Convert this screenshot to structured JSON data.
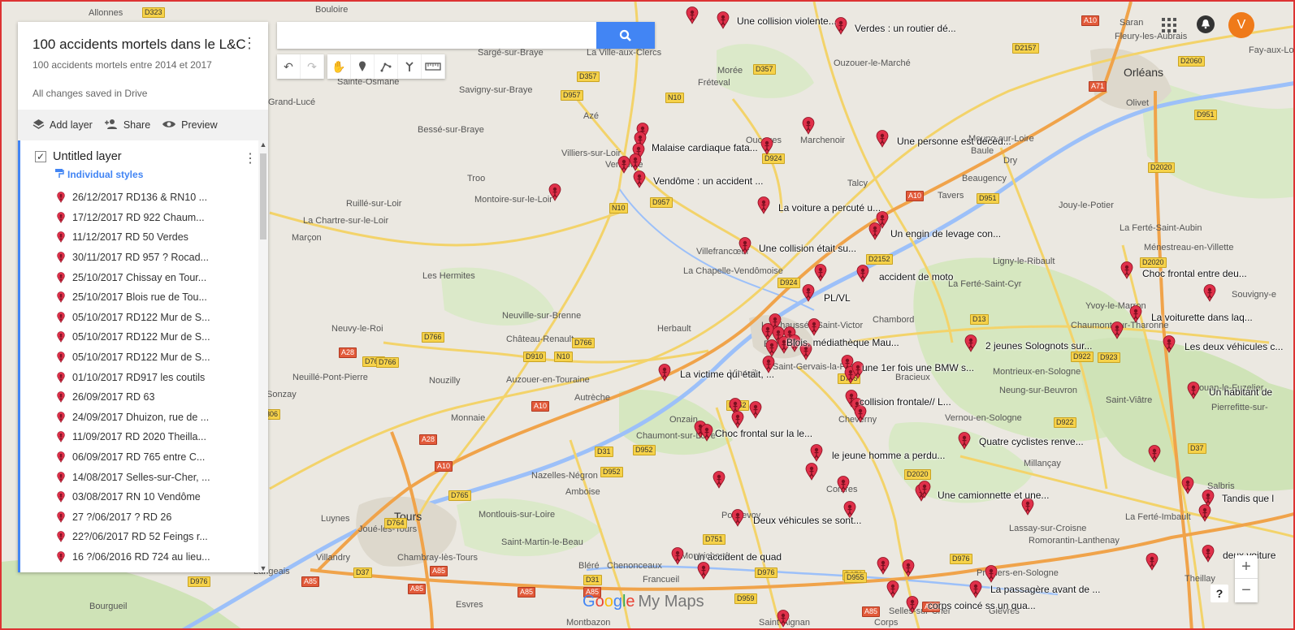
{
  "map_panel": {
    "title": "100 accidents mortels dans le L&C",
    "subtitle": "100 accidents mortels entre 2014 et 2017",
    "saved_status": "All changes saved in Drive",
    "actions": {
      "add_layer": "Add layer",
      "share": "Share",
      "preview": "Preview"
    },
    "layer": {
      "name": "Untitled layer",
      "styles_link": "Individual styles",
      "items": [
        "26/12/2017 RD136 & RN10 ...",
        "17/12/2017  RD 922 Chaum...",
        "11/12/2017 RD 50 Verdes",
        "30/11/2017 RD 957 ?  Rocad...",
        "25/10/2017 Chissay en Tour...",
        "25/10/2017 Blois rue de Tou...",
        "05/10/2017 RD122 Mur de S...",
        "05/10/2017 RD122 Mur de S...",
        "05/10/2017 RD122 Mur de S...",
        "01/10/2017  RD917 les coutils",
        "26/09/2017 RD 63",
        "24/09/2017  Dhuizon, rue de ...",
        "11/09/2017 RD 2020 Theilla...",
        "06/09/2017  RD 765 entre C...",
        "14/08/2017  Selles-sur-Cher, ...",
        "03/08/2017 RN 10 Vendôme",
        "27 ?/06/2017 ? RD 26",
        "22?/06/2017 RD 52 Feings r...",
        "16 ?/06/2016 RD 724 au lieu..."
      ]
    }
  },
  "search": {
    "placeholder": ""
  },
  "toolbar": [
    "undo-icon",
    "redo-icon",
    "hand-icon",
    "marker-icon",
    "draw-line-icon",
    "directions-icon",
    "ruler-icon"
  ],
  "top_right": {
    "avatar_letter": "V"
  },
  "branding": {
    "google": [
      "G",
      "o",
      "o",
      "g",
      "l",
      "e"
    ],
    "product": "My Maps"
  },
  "zoom": {
    "in": "+",
    "out": "−"
  },
  "help": "?",
  "colors": {
    "marker": "#e0304a",
    "accent": "#4285f4",
    "avatar": "#ef7a1a",
    "road_yellow": "#f6d24a",
    "road_red": "#e25a3a"
  },
  "map": {
    "places": [
      {
        "t": "Allonnes"
      },
      {
        "t": "Bouloire"
      },
      {
        "t": "Sargé-sur-Braye"
      },
      {
        "t": "La Ville-aux-Clercs"
      },
      {
        "t": "Morée"
      },
      {
        "t": "Fréteval"
      },
      {
        "t": "Ouzouer-le-Marché"
      },
      {
        "t": "Saran"
      },
      {
        "t": "Fleury-les-Aubrais"
      },
      {
        "t": "Orléans",
        "big": true
      },
      {
        "t": "Olivet"
      },
      {
        "t": "Fay-aux-Log"
      },
      {
        "t": "Sainte-Osmane"
      },
      {
        "t": "Savigny-sur-Braye"
      },
      {
        "t": "Grand-Lucé"
      },
      {
        "t": "Azé"
      },
      {
        "t": "Bessé-sur-Braye"
      },
      {
        "t": "Villiers-sur-Loir"
      },
      {
        "t": "Vendôme"
      },
      {
        "t": "Troo"
      },
      {
        "t": "Montoire-sur-le-Loir"
      },
      {
        "t": "Ruillé-sur-Loir"
      },
      {
        "t": "La Chartre-sur-le-Loir"
      },
      {
        "t": "Marçon"
      },
      {
        "t": "Oucques"
      },
      {
        "t": "Marchenoir"
      },
      {
        "t": "Meung-sur-Loire"
      },
      {
        "t": "Baule"
      },
      {
        "t": "Beaugency"
      },
      {
        "t": "Talcy"
      },
      {
        "t": "Tavers"
      },
      {
        "t": "Jouy-le-Potier"
      },
      {
        "t": "Dry"
      },
      {
        "t": "La Ferté-Saint-Aubin"
      },
      {
        "t": "Ménestreau-en-Villette"
      },
      {
        "t": "Villefrancœur"
      },
      {
        "t": "La Chapelle-Vendômoise"
      },
      {
        "t": "Les Hermites"
      },
      {
        "t": "Ligny-le-Ribault"
      },
      {
        "t": "La Ferté-Saint-Cyr"
      },
      {
        "t": "Yvoy-le-Marron"
      },
      {
        "t": "Souvigny-e"
      },
      {
        "t": "Neuville-sur-Brenne"
      },
      {
        "t": "Château-Renault"
      },
      {
        "t": "Herbault"
      },
      {
        "t": "Chambord"
      },
      {
        "t": "Chaumont-sur-Tharonne"
      },
      {
        "t": "Neuvy-le-Roi"
      },
      {
        "t": "Neuillé-Pont-Pierre"
      },
      {
        "t": "Nouzilly"
      },
      {
        "t": "Auzouer-en-Touraine"
      },
      {
        "t": "Autrèche"
      },
      {
        "t": "Bracieux"
      },
      {
        "t": "Montrieux-en-Sologne"
      },
      {
        "t": "Neung-sur-Beuvron"
      },
      {
        "t": "Sonzay"
      },
      {
        "t": "Monnaie"
      },
      {
        "t": "Onzain"
      },
      {
        "t": "Chaumont-sur-Loire"
      },
      {
        "t": "Cheverny"
      },
      {
        "t": "Vernou-en-Sologne"
      },
      {
        "t": "Saint-Viâtre"
      },
      {
        "t": "Nouan-le-Fuzelier"
      },
      {
        "t": "Pierrefitte-sur-"
      },
      {
        "t": "Nazelles-Négron"
      },
      {
        "t": "Amboise"
      },
      {
        "t": "Millançay"
      },
      {
        "t": "Salbris"
      },
      {
        "t": "Tours",
        "big": true
      },
      {
        "t": "Montlouis-sur-Loire"
      },
      {
        "t": "Pontlevoy"
      },
      {
        "t": "Contres"
      },
      {
        "t": "Luynes"
      },
      {
        "t": "Joué-lès-Tours"
      },
      {
        "t": "Saint-Martin-le-Beau"
      },
      {
        "t": "Lassay-sur-Croisne"
      },
      {
        "t": "La Ferté-Imbault"
      },
      {
        "t": "Chambray-lès-Tours"
      },
      {
        "t": "Romorantin-Lanthenay"
      },
      {
        "t": "Villandry"
      },
      {
        "t": "Chenonceaux"
      },
      {
        "t": "Montrichard"
      },
      {
        "t": "Pruniers-en-Sologne"
      },
      {
        "t": "Langeais"
      },
      {
        "t": "Bléré"
      },
      {
        "t": "Francueil"
      },
      {
        "t": "Theillay"
      },
      {
        "t": "Bourgueil"
      },
      {
        "t": "Esvres"
      },
      {
        "t": "Selles-sur-Cher"
      },
      {
        "t": "Gièvres"
      },
      {
        "t": "Montbazon"
      },
      {
        "t": "Corps"
      },
      {
        "t": "Saint-Aignan"
      },
      {
        "t": "Blois"
      },
      {
        "t": "Vineuil"
      },
      {
        "t": "Saint-Gervais-la-Forêt"
      },
      {
        "t": "La Chaussée-Saint-Victor"
      }
    ],
    "roads": [
      {
        "t": "D323"
      },
      {
        "t": "D357"
      },
      {
        "t": "D957"
      },
      {
        "t": "N10"
      },
      {
        "t": "D357"
      },
      {
        "t": "D2157"
      },
      {
        "t": "A10",
        "red": true
      },
      {
        "t": "D2060"
      },
      {
        "t": "A71",
        "red": true
      },
      {
        "t": "D951"
      },
      {
        "t": "D924"
      },
      {
        "t": "D957"
      },
      {
        "t": "N10"
      },
      {
        "t": "D2020"
      },
      {
        "t": "A10",
        "red": true
      },
      {
        "t": "D951"
      },
      {
        "t": "D2152"
      },
      {
        "t": "D924"
      },
      {
        "t": "D2020"
      },
      {
        "t": "D13"
      },
      {
        "t": "D922"
      },
      {
        "t": "D923"
      },
      {
        "t": "D766"
      },
      {
        "t": "D766"
      },
      {
        "t": "D910"
      },
      {
        "t": "N10"
      },
      {
        "t": "D766"
      },
      {
        "t": "A28",
        "red": true
      },
      {
        "t": "D766"
      },
      {
        "t": "A10",
        "red": true
      },
      {
        "t": "D765"
      },
      {
        "t": "D952"
      },
      {
        "t": "D922"
      },
      {
        "t": "A28",
        "red": true
      },
      {
        "t": "D31"
      },
      {
        "t": "D952"
      },
      {
        "t": "A10",
        "red": true
      },
      {
        "t": "D952"
      },
      {
        "t": "D765"
      },
      {
        "t": "D2020"
      },
      {
        "t": "D37"
      },
      {
        "t": "D764"
      },
      {
        "t": "D751"
      },
      {
        "t": "D37"
      },
      {
        "t": "A85",
        "red": true
      },
      {
        "t": "A85",
        "red": true
      },
      {
        "t": "D976"
      },
      {
        "t": "D31"
      },
      {
        "t": "A85",
        "red": true
      },
      {
        "t": "D976"
      },
      {
        "t": "D976"
      },
      {
        "t": "D976"
      },
      {
        "t": "A85",
        "red": true
      },
      {
        "t": "A85",
        "red": true
      },
      {
        "t": "A10",
        "red": true
      },
      {
        "t": "A85",
        "red": true
      },
      {
        "t": "D959"
      },
      {
        "t": "D955"
      },
      {
        "t": "306"
      }
    ],
    "marker_labels": [
      "Une collision violente...",
      "Verdes : un routier dé...",
      "Malaise cardiaque fata...",
      "Une personne est décéd...",
      "Vendôme : un accident ...",
      "La voiture a percuté u...",
      "Un engin de levage con...",
      "Une collision était su...",
      "Choc frontal entre deu...",
      "accident de moto",
      "PL/VL",
      "La voiturette dans laq...",
      "Blois, médiathèque Mau...",
      "2 jeunes Solognots sur...",
      "Les deux véhicules c...",
      "une 1er fois une BMW s...",
      "La victime qui était, ...",
      "Un habitant de",
      "collision frontale// L...",
      "Choc frontal sur la le...",
      "Quatre cyclistes renve...",
      "le jeune homme a perdu...",
      "Une camionnette et une...",
      "Tandis que l",
      "Deux véhicules se sont...",
      "un accident de quad",
      "deux voiture",
      "La passagère avant de ...",
      "corps coincé ss un qua..."
    ]
  }
}
